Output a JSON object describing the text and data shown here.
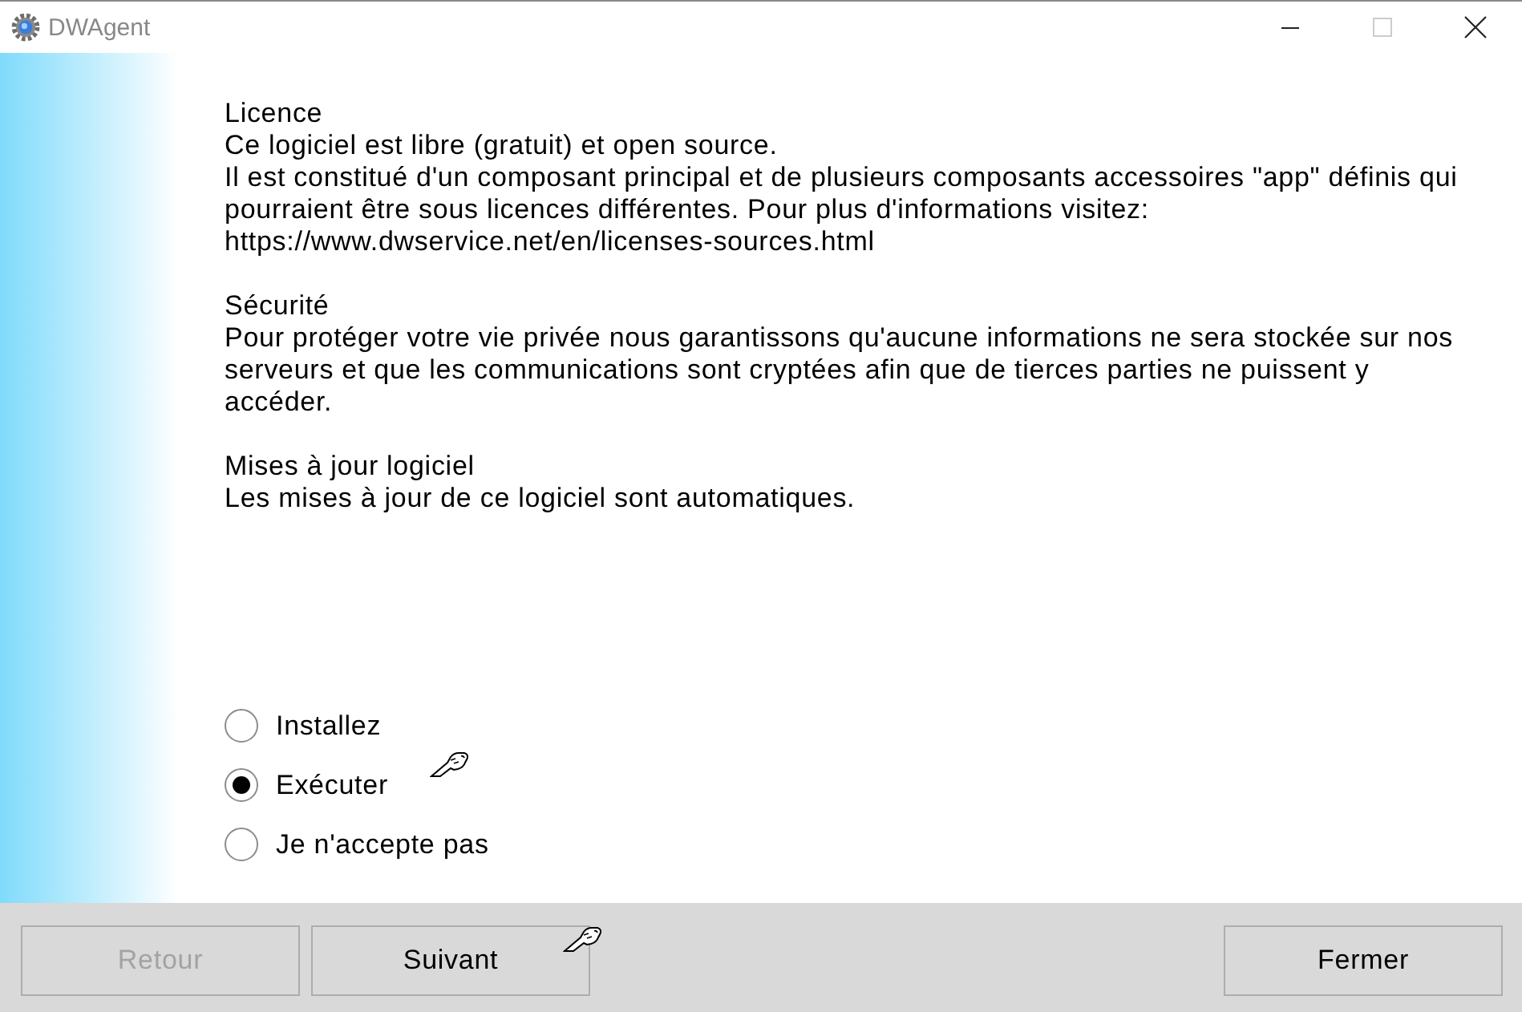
{
  "window": {
    "title": "DWAgent",
    "maximize_disabled": true
  },
  "sections": [
    {
      "heading": "Licence",
      "paragraphs": [
        "Ce logiciel est libre (gratuit) et open source.",
        "Il est constitué d'un composant principal et de plusieurs composants accessoires \"app\" définis qui pourraient être sous licences différentes. Pour plus d'informations visitez: https://www.dwservice.net/en/licenses-sources.html"
      ]
    },
    {
      "heading": "Sécurité",
      "paragraphs": [
        "Pour protéger votre vie privée nous garantissons qu'aucune informations ne sera stockée sur nos serveurs et que les communications sont cryptées afin que de tierces parties ne puissent y accéder."
      ]
    },
    {
      "heading": "Mises à jour logiciel",
      "paragraphs": [
        "Les mises à jour de ce logiciel sont automatiques."
      ]
    }
  ],
  "options": [
    {
      "label": "Installez",
      "selected": false
    },
    {
      "label": "Exécuter",
      "selected": true
    },
    {
      "label": "Je n'accepte pas",
      "selected": false
    }
  ],
  "footer": {
    "nav_buttons": [
      {
        "label": "Retour",
        "disabled": true
      },
      {
        "label": "Suivant",
        "disabled": false
      }
    ],
    "close_button": {
      "label": "Fermer",
      "disabled": false
    }
  }
}
